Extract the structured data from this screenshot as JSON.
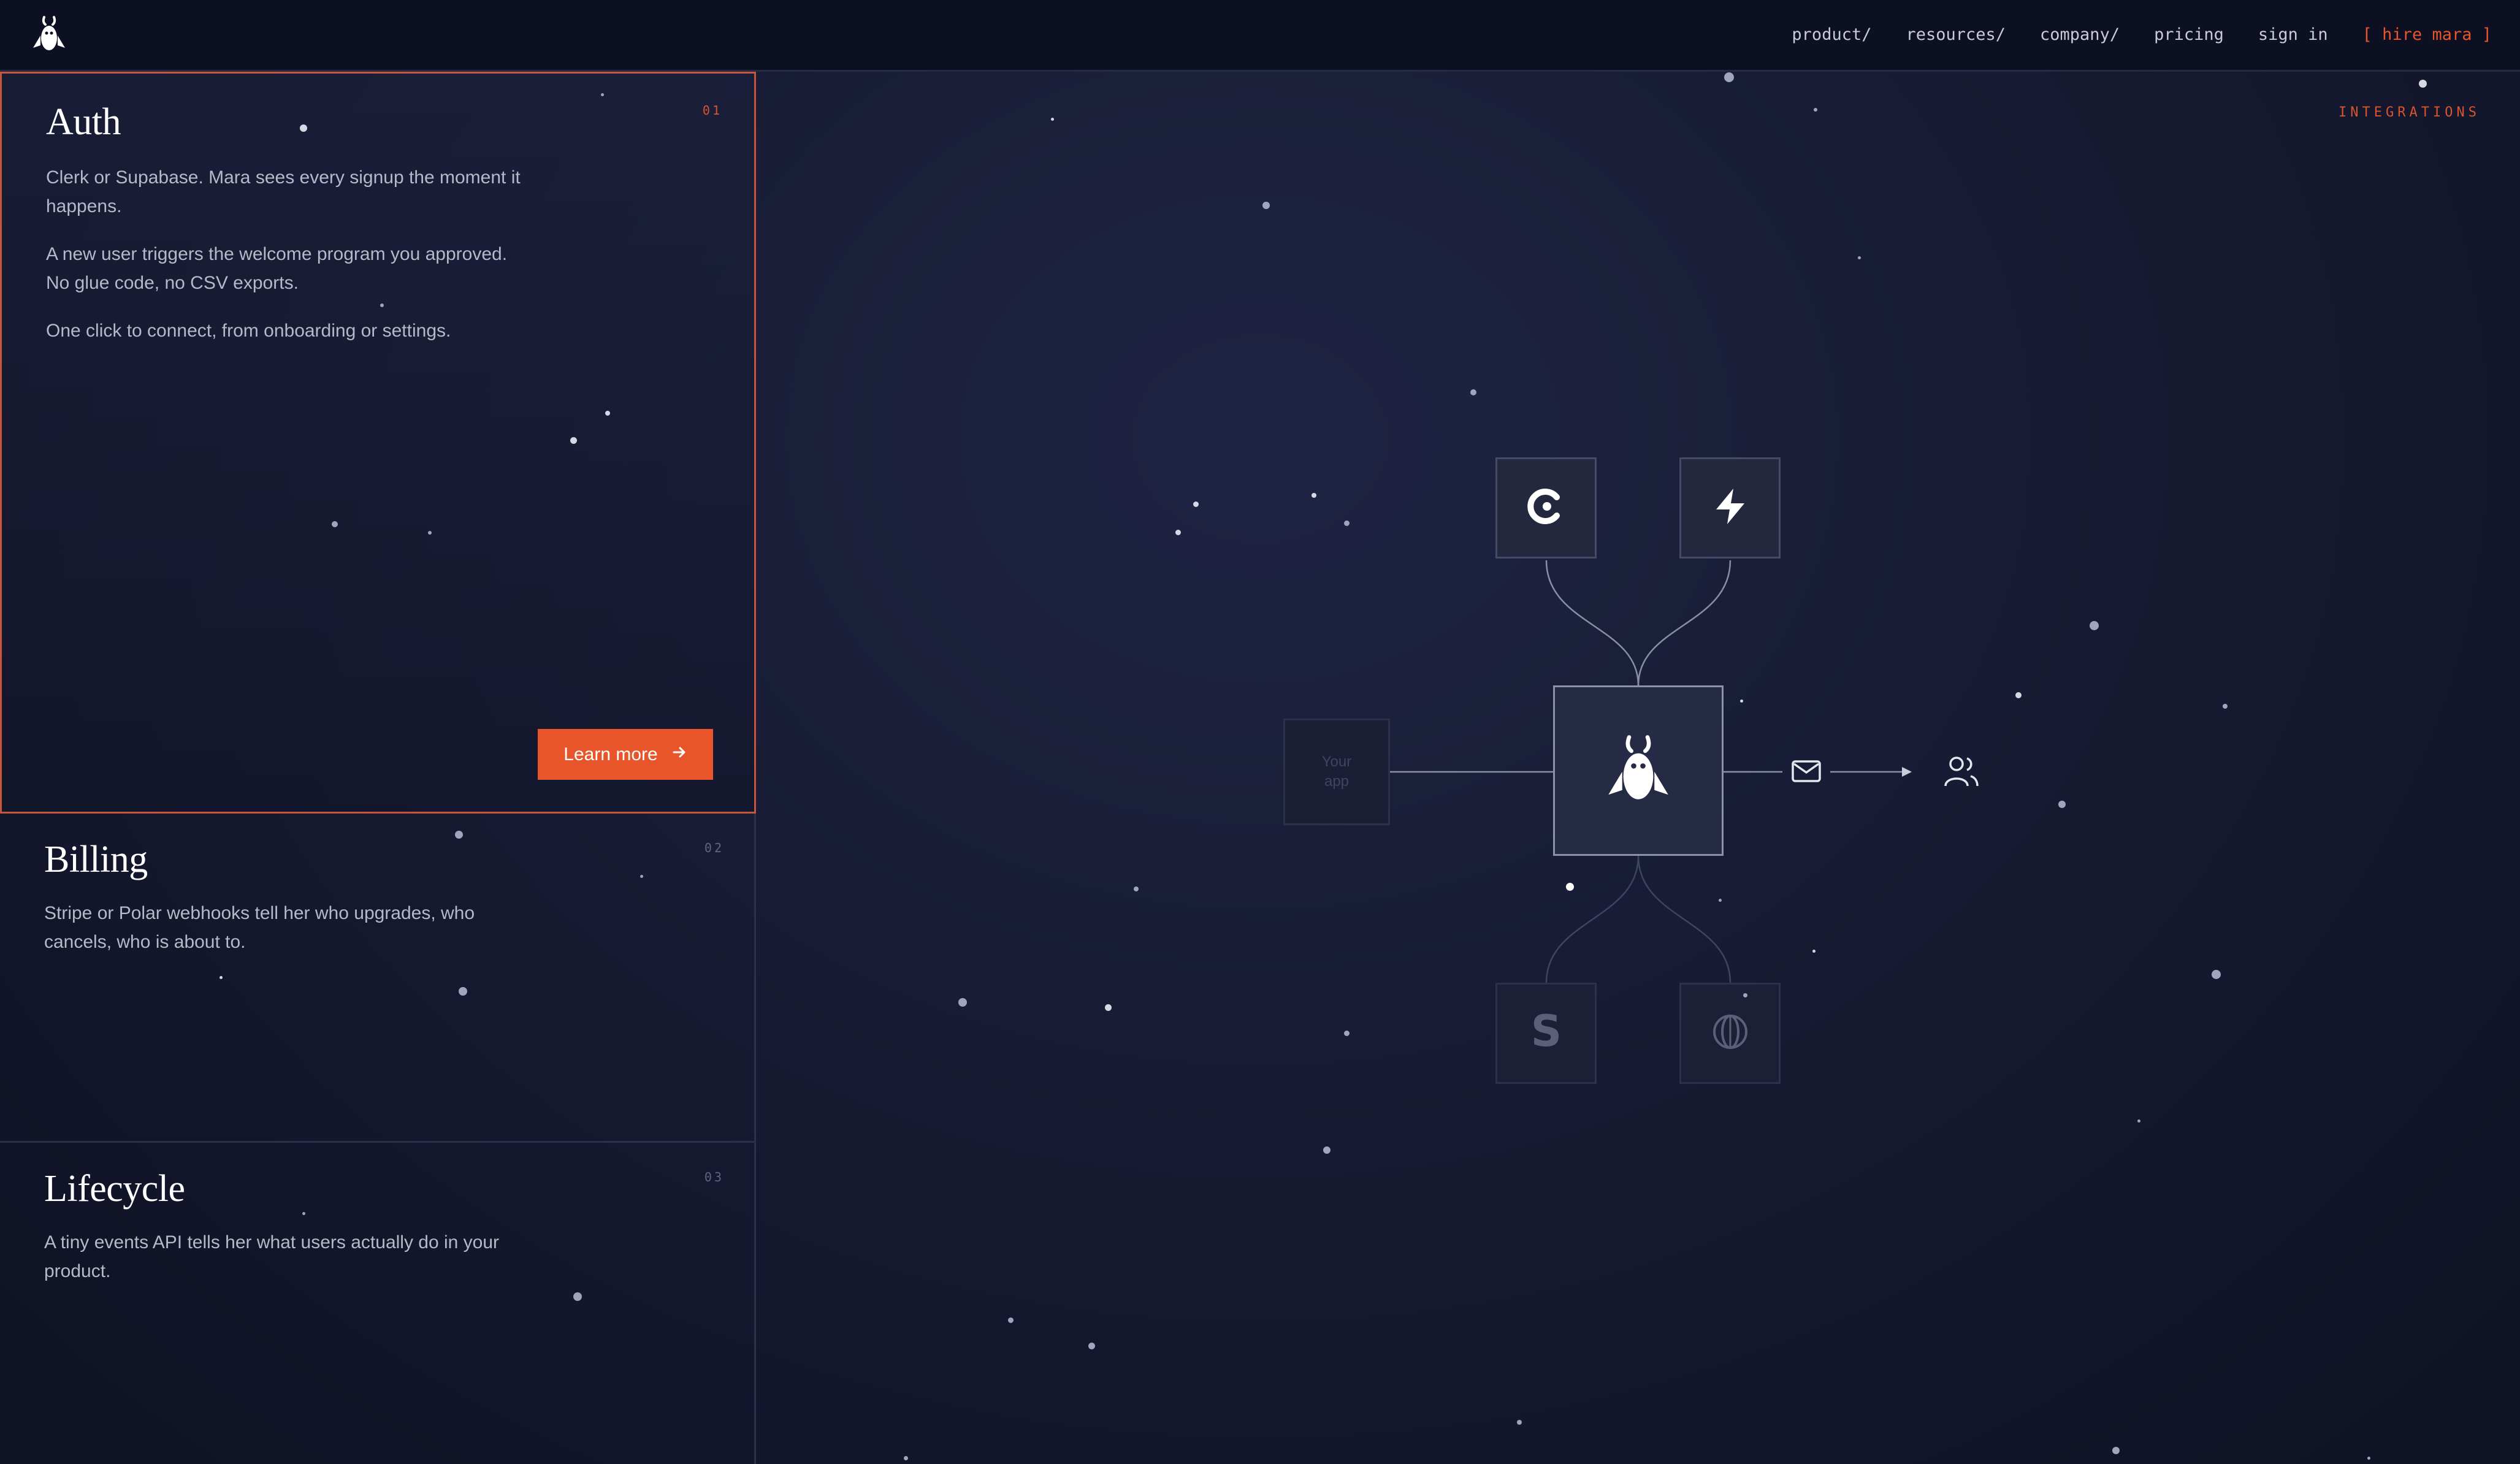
{
  "nav": {
    "logo_icon": "mara-bunny-logo-icon",
    "links": [
      "product/",
      "resources/",
      "company/",
      "pricing",
      "sign in"
    ],
    "cta": "[ hire mara ]"
  },
  "cards": [
    {
      "title": "Auth",
      "number": "01",
      "paragraphs": [
        "Clerk or Supabase. Mara sees every signup the moment it happens.",
        "A new user triggers the welcome program you approved. No glue code, no CSV exports.",
        "One click to connect, from onboarding or settings."
      ],
      "button": "Learn more"
    },
    {
      "title": "Billing",
      "number": "02",
      "paragraphs": [
        "Stripe or Polar webhooks tell her who upgrades, who cancels, who is about to."
      ]
    },
    {
      "title": "Lifecycle",
      "number": "03",
      "paragraphs": [
        "A tiny events API tells her what users actually do in your product."
      ]
    }
  ],
  "diagram": {
    "section_label": "INTEGRATIONS",
    "your_app_label": "Your app",
    "top_nodes": [
      "clerk-icon",
      "supabase-icon"
    ],
    "bottom_nodes": [
      "stripe-icon",
      "polar-icon"
    ],
    "center_icon": "mara-bunny-icon",
    "output_icons": [
      "mail-icon",
      "users-icon"
    ]
  },
  "colors": {
    "accent": "#e8552a",
    "background": "#12162b"
  }
}
